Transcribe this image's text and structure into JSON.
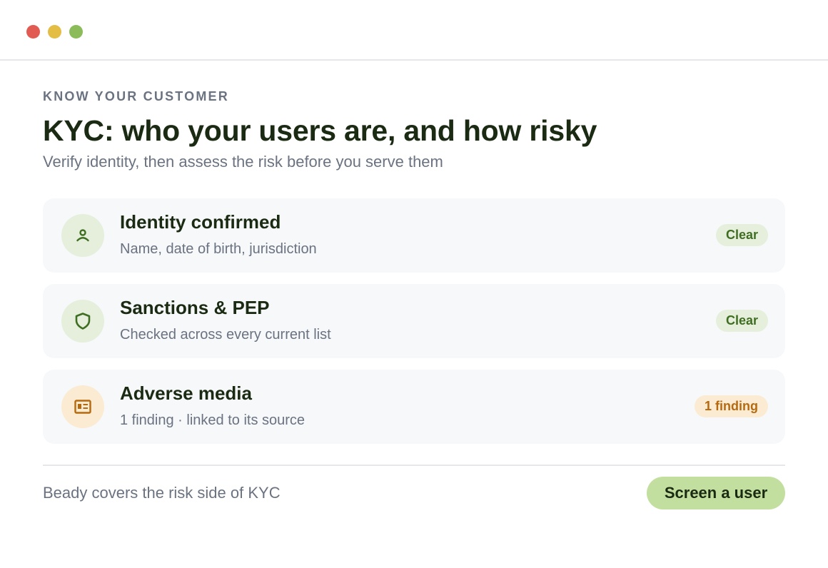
{
  "window": {
    "controls": [
      "close",
      "minimize",
      "maximize"
    ]
  },
  "header": {
    "eyebrow": "KNOW YOUR CUSTOMER",
    "title": "KYC: who your users are, and how risky",
    "subtitle": "Verify identity, then assess the risk before you serve them"
  },
  "checks": [
    {
      "icon": "person-icon",
      "title": "Identity confirmed",
      "description": "Name, date of birth, jurisdiction",
      "status": "Clear",
      "status_color": "#3f6e22"
    },
    {
      "icon": "shield-icon",
      "title": "Sanctions & PEP",
      "description": "Checked across every current list",
      "status": "Clear",
      "status_color": "#3f6e22"
    },
    {
      "icon": "newspaper-icon",
      "title": "Adverse media",
      "description": "1 finding · linked to its source",
      "status": "1 finding",
      "status_color": "#b66a10"
    }
  ],
  "footer": {
    "note": "Beady covers the risk side of KYC",
    "cta_label": "Screen a user"
  },
  "colors": {
    "accent": "#c3df9f",
    "ok_bg": "#e5efdc",
    "warn_bg": "#fbebd2",
    "heading": "#1b2a12"
  }
}
